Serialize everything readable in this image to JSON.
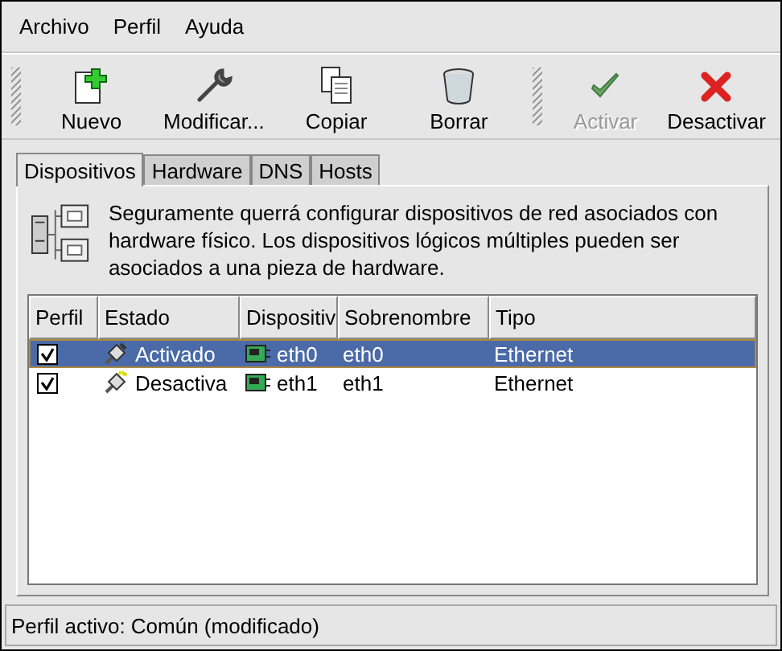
{
  "menu": [
    "Archivo",
    "Perfil",
    "Ayuda"
  ],
  "toolbar": [
    {
      "label": "Nuevo",
      "kind": "new",
      "disabled": false
    },
    {
      "label": "Modificar...",
      "kind": "edit",
      "disabled": false
    },
    {
      "label": "Copiar",
      "kind": "copy",
      "disabled": false
    },
    {
      "label": "Borrar",
      "kind": "delete",
      "disabled": false
    },
    {
      "label": "Activar",
      "kind": "activate",
      "disabled": true
    },
    {
      "label": "Desactivar",
      "kind": "deactivate",
      "disabled": false
    }
  ],
  "tabs": [
    {
      "label": "Dispositivos",
      "selected": true
    },
    {
      "label": "Hardware",
      "selected": false
    },
    {
      "label": "DNS",
      "selected": false
    },
    {
      "label": "Hosts",
      "selected": false
    }
  ],
  "intro": "Seguramente querrá configurar dispositivos de red asociados con hardware físico. Los dispositivos lógicos múltiples pueden ser asociados a una pieza de hardware.",
  "table": {
    "columns": [
      "Perfil",
      "Estado",
      "Dispositiv",
      "Sobrenombre",
      "Tipo"
    ],
    "rows": [
      {
        "checked": true,
        "selected": true,
        "active": true,
        "status": "Activado",
        "device": "eth0",
        "nickname": "eth0",
        "type": "Ethernet"
      },
      {
        "checked": true,
        "selected": false,
        "active": false,
        "status": "Desactiva",
        "device": "eth1",
        "nickname": "eth1",
        "type": "Ethernet"
      }
    ]
  },
  "status_bar": "Perfil activo: Común (modificado)"
}
